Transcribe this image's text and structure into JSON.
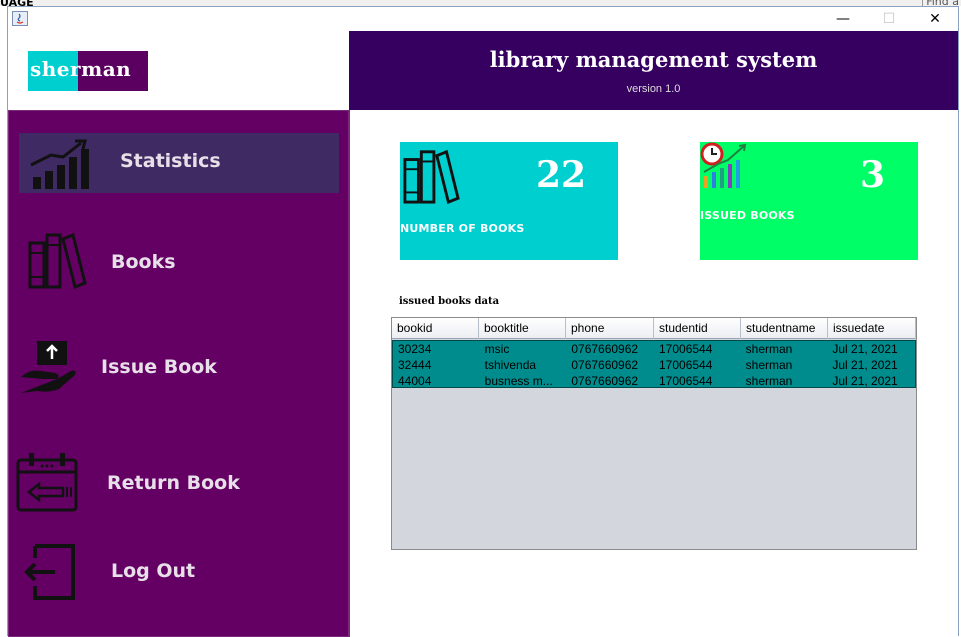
{
  "desktop": {
    "left_text": "UAGE",
    "right_text": "Find a"
  },
  "window": {
    "min_glyph": "—",
    "max_glyph": "☐",
    "close_glyph": "✕"
  },
  "logo": {
    "text": "sherman"
  },
  "header": {
    "title": "library management system",
    "version": "version 1.0"
  },
  "sidebar": {
    "items": [
      {
        "label": "Statistics",
        "icon": "chart-icon",
        "active": true
      },
      {
        "label": "Books",
        "icon": "books-icon",
        "active": false
      },
      {
        "label": "Issue Book",
        "icon": "issue-hand-icon",
        "active": false
      },
      {
        "label": "Return Book",
        "icon": "calendar-return-icon",
        "active": false
      },
      {
        "label": "Log Out",
        "icon": "logout-icon",
        "active": false
      }
    ]
  },
  "cards": {
    "books": {
      "count": "22",
      "label": "NUMBER OF BOOKS"
    },
    "issued": {
      "count": "3",
      "label": "ISSUED BOOKS"
    }
  },
  "table": {
    "caption": "issued books data",
    "columns": [
      "bookid",
      "booktitle",
      "phone",
      "studentid",
      "studentname",
      "issuedate"
    ],
    "rows": [
      [
        "30234",
        "msic",
        "0767660962",
        "17006544",
        "sherman",
        "Jul 21, 2021"
      ],
      [
        "32444",
        "tshivenda",
        "0767660962",
        "17006544",
        "sherman",
        "Jul 21, 2021"
      ],
      [
        "44004",
        "busness m...",
        "0767660962",
        "17006544",
        "sherman",
        "Jul 21, 2021"
      ]
    ]
  },
  "colors": {
    "sidebar": "#640064",
    "header": "#360060",
    "active_item": "#3f2a64",
    "card_books": "#00cfcf",
    "card_issued": "#00ff66",
    "table_selection": "#008c8c"
  }
}
